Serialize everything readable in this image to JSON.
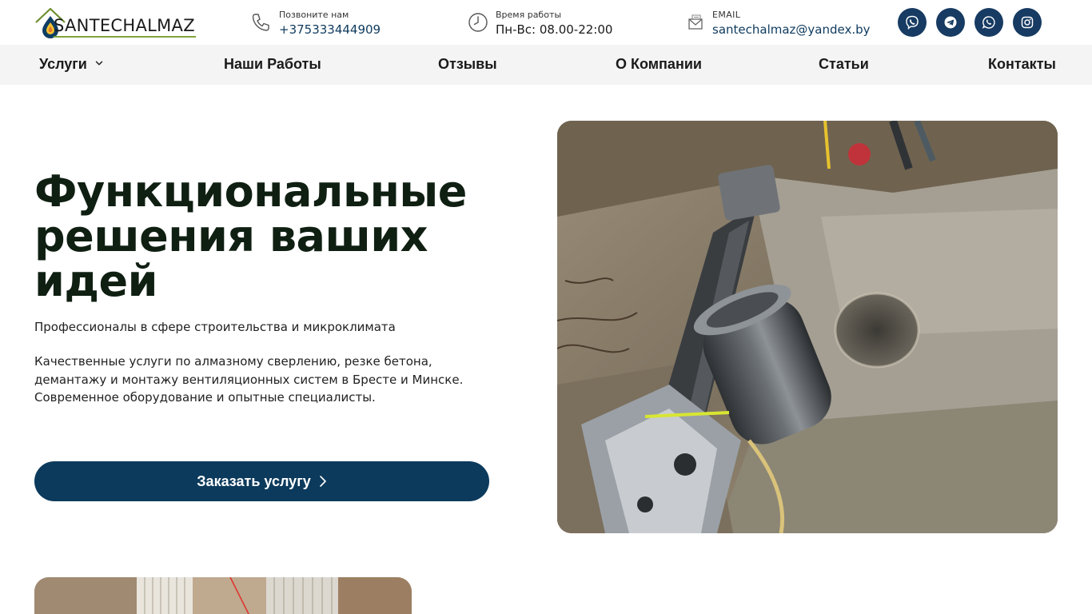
{
  "brand": {
    "name": "SANTECHALMAZ"
  },
  "header": {
    "phone": {
      "label": "Позвоните нам",
      "value": "+375333444909"
    },
    "hours": {
      "label": "Время работы",
      "value": "Пн-Вс: 08.00-22:00"
    },
    "email": {
      "label": "EMAIL",
      "value": "santechalmaz@yandex.by"
    },
    "socials": [
      {
        "icon": "viber-icon"
      },
      {
        "icon": "telegram-icon"
      },
      {
        "icon": "whatsapp-icon"
      },
      {
        "icon": "instagram-icon"
      }
    ]
  },
  "nav": {
    "items": [
      {
        "label": "Услуги",
        "has_dropdown": true
      },
      {
        "label": "Наши Работы"
      },
      {
        "label": "Отзывы"
      },
      {
        "label": "О Компании"
      },
      {
        "label": "Статьи"
      },
      {
        "label": "Контакты"
      }
    ]
  },
  "hero": {
    "title_line1": "Функциональные",
    "title_line2": "решения ваших",
    "title_line3": "идей",
    "subtitle": "Профессионалы в сфере строительства и микроклимата",
    "desc_line1": "Качественные услуги по алмазному сверлению, резке бетона,",
    "desc_line2": "демантажу и монтажу вентиляционных систем в Бресте и Минске.",
    "desc_line3": "Современное оборудование и опытные специалисты.",
    "cta_label": "Заказать услугу"
  },
  "colors": {
    "primary": "#0c3a5c",
    "social_bg": "#173b62",
    "nav_bg": "#f4f4f4",
    "title": "#0f1f12",
    "logo_accent": "#7fa33a"
  }
}
